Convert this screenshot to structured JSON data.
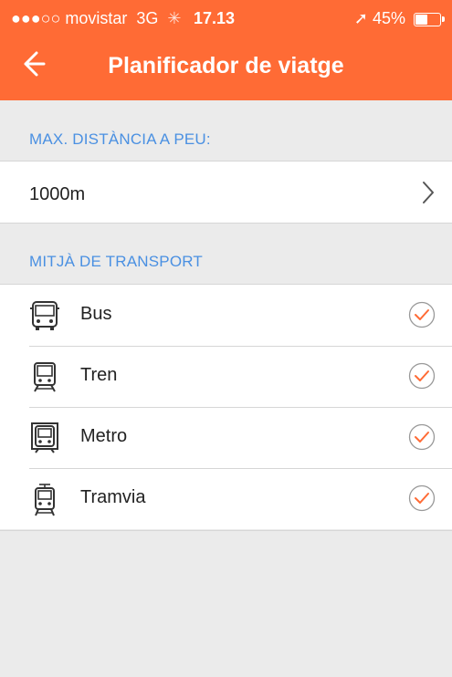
{
  "status_bar": {
    "carrier": "●●●○○ movistar",
    "network": "3G",
    "time": "17.13",
    "battery": "45%",
    "battery_level": 0.45
  },
  "header": {
    "title": "Planificador de viatge",
    "back_icon": "arrow-left-icon",
    "background_color": "#ff6b35"
  },
  "walking": {
    "section_label": "MAX. DISTÀNCIA A PEU:",
    "value": "1000m",
    "chevron_icon": "chevron-right-icon"
  },
  "transport": {
    "section_label": "MITJÀ DE TRANSPORT",
    "items": [
      {
        "label": "Bus",
        "icon": "bus-icon",
        "checked": true
      },
      {
        "label": "Tren",
        "icon": "train-icon",
        "checked": true
      },
      {
        "label": "Metro",
        "icon": "metro-icon",
        "checked": true
      },
      {
        "label": "Tramvia",
        "icon": "tram-icon",
        "checked": true
      }
    ]
  },
  "colors": {
    "accent": "#ff6b35",
    "section_text": "#4a90e2",
    "background": "#ebebeb"
  }
}
